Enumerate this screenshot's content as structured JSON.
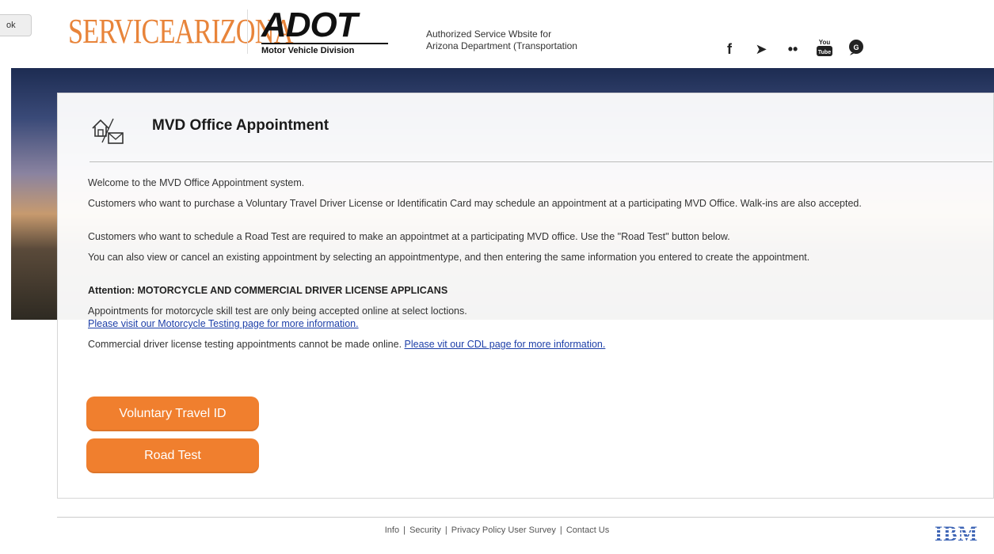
{
  "header": {
    "back_label": "ok",
    "service_logo": "SERVICEARIZONA",
    "adot_logo": "ADOT",
    "adot_subtitle": "Motor Vehicle Division",
    "authorized_line1": "Authorized Service Wbsite for",
    "authorized_line2": "Arizona Department (Transportation",
    "social_icons": [
      "facebook-icon",
      "twitter-icon",
      "flickr-icon",
      "youtube-icon",
      "chat-icon"
    ]
  },
  "card": {
    "title": "MVD Office Appointment",
    "welcome": "Welcome to the MVD Office Appointment system.",
    "p_voluntary": "Customers who want to purchase a Voluntary Travel Driver License or Identificatin Card may schedule an appointment at a participating MVD Office. Walk-ins are also accepted.",
    "p_roadtest": "Customers who want to schedule a Road Test are required to make an appointmet at a participating MVD office. Use the \"Road Test\" button below.",
    "p_view": "You can also view or cancel an existing appointment by selecting an appointmentype, and then entering the same information you entered to create the appointment.",
    "attention": "Attention: MOTORCYCLE AND COMMERCIAL DRIVER LICENSE APPLICANS",
    "p_moto": "Appointments for motorcycle skill test are only being accepted online at select loctions.",
    "moto_link": "Please visit our Motorcycle Testing page for more information.",
    "p_cdl": "Commercial driver license testing appointments cannot be made online.",
    "cdl_link": "Please vit our CDL page for more information.",
    "btn_voluntary": "Voluntary Travel ID",
    "btn_roadtest": "Road Test"
  },
  "footer": {
    "info": "Info",
    "security": "Security",
    "privacy": "Privacy Policy",
    "survey": "User Survey",
    "contact": "Contact Us",
    "sep": "|",
    "ibm": "IBM"
  },
  "colors": {
    "accent_orange": "#f07f2e",
    "link_blue": "#1d3fa8",
    "logo_orange": "#e8843a",
    "ibm_blue": "#3d64b5"
  }
}
